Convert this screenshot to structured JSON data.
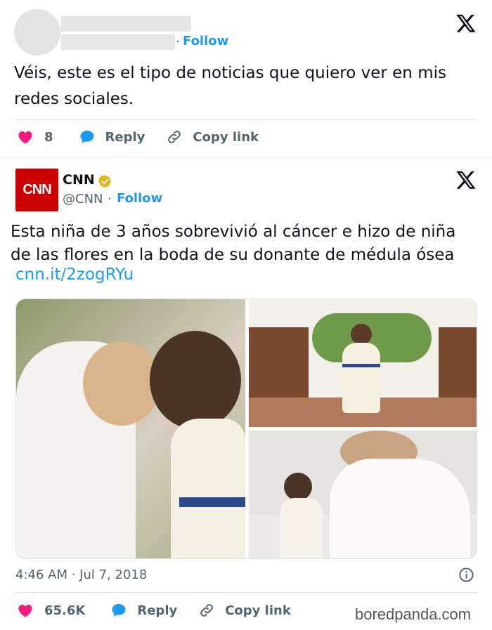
{
  "tweet1": {
    "follow_sep": "·",
    "follow_label": "Follow",
    "text_line1": "Véis, este es el tipo de noticias que quiero ver en mis",
    "text_line2": "redes sociales.",
    "likes": "8",
    "reply_label": "Reply",
    "copy_label": "Copy link"
  },
  "tweet2": {
    "logo_text": "CNN",
    "name": "CNN",
    "handle": "@CNN",
    "follow_sep": "·",
    "follow_label": "Follow",
    "text_line1": "Esta niña de 3 años sobrevivió al cáncer e hizo de niña",
    "text_line2": "de las flores en la boda de su donante de médula ósea",
    "link": "cnn.it/2zogRYu",
    "timestamp": "4:46 AM · Jul 7, 2018",
    "likes": "65.6K",
    "reply_label": "Reply",
    "copy_label": "Copy link"
  },
  "watermark": "boredpanda.com",
  "colors": {
    "accent": "#1d9bf0",
    "like": "#f91880",
    "cnn_red": "#cc0000",
    "verified_gold": "#e2b719"
  }
}
